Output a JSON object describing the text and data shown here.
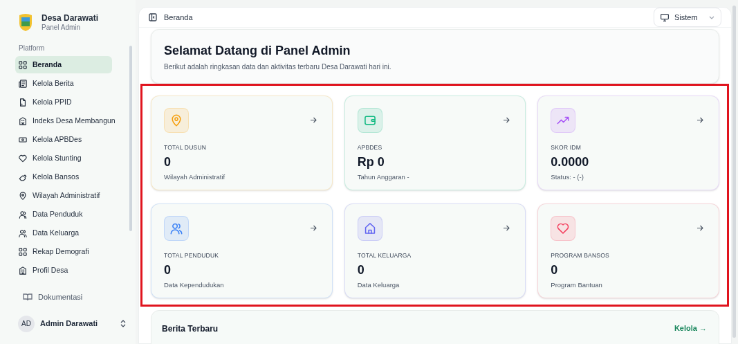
{
  "sidebar": {
    "brand": {
      "title": "Desa Darawati",
      "subtitle": "Panel Admin"
    },
    "section": "Platform",
    "items": [
      {
        "label": "Beranda",
        "kind": "grid",
        "selected": true
      },
      {
        "label": "Kelola Berita",
        "kind": "news",
        "selected": false
      },
      {
        "label": "Kelola PPID",
        "kind": "file",
        "selected": false
      },
      {
        "label": "Indeks Desa Membangun",
        "kind": "building",
        "selected": false
      },
      {
        "label": "Kelola APBDes",
        "kind": "money",
        "selected": false
      },
      {
        "label": "Kelola Stunting",
        "kind": "heart",
        "selected": false
      },
      {
        "label": "Kelola Bansos",
        "kind": "hand",
        "selected": false
      },
      {
        "label": "Wilayah Administratif",
        "kind": "pin",
        "selected": false
      },
      {
        "label": "Data Penduduk",
        "kind": "user",
        "selected": false
      },
      {
        "label": "Data Keluarga",
        "kind": "users",
        "selected": false
      },
      {
        "label": "Rekap Demografi",
        "kind": "grid",
        "selected": false
      },
      {
        "label": "Profil Desa",
        "kind": "building",
        "selected": false
      }
    ],
    "docs_link": "Dokumentasi",
    "user": {
      "initials": "AD",
      "name": "Admin Darawati"
    }
  },
  "header": {
    "breadcrumb": "Beranda",
    "theme_select": "Sistem"
  },
  "welcome": {
    "title": "Selamat Datang di Panel Admin",
    "subtitle": "Berikut adalah ringkasan data dan aktivitas terbaru Desa Darawati hari ini."
  },
  "stat_cards": [
    {
      "label": "TOTAL DUSUN",
      "value": "0",
      "caption": "Wilayah Administratif",
      "kind": "pin",
      "color": "#f59e0b"
    },
    {
      "label": "APBDES",
      "value": "Rp 0",
      "caption": "Tahun Anggaran -",
      "kind": "wallet",
      "color": "#10b981"
    },
    {
      "label": "SKOR IDM",
      "value": "0.0000",
      "caption": "Status: - (-)",
      "kind": "trend",
      "color": "#a855f7"
    },
    {
      "label": "TOTAL PENDUDUK",
      "value": "0",
      "caption": "Data Kependudukan",
      "kind": "users",
      "color": "#3b82f6"
    },
    {
      "label": "TOTAL KELUARGA",
      "value": "0",
      "caption": "Data Keluarga",
      "kind": "home",
      "color": "#6366f1"
    },
    {
      "label": "PROGRAM BANSOS",
      "value": "0",
      "caption": "Program Bantuan",
      "kind": "heart",
      "color": "#f43f5e"
    }
  ],
  "news": {
    "title": "Berita Terbaru",
    "link": "Kelola →"
  }
}
